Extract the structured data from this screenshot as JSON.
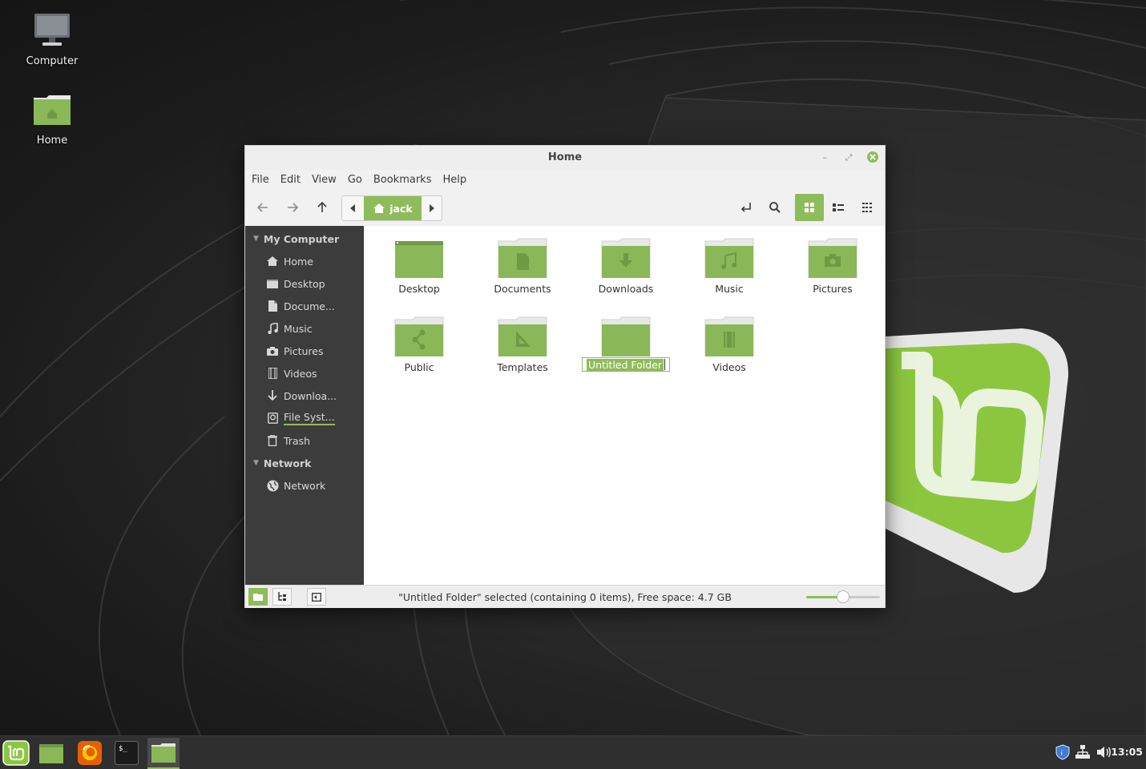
{
  "desktop": {
    "icons": [
      {
        "label": "Computer"
      },
      {
        "label": "Home"
      }
    ]
  },
  "window": {
    "title": "Home",
    "menu": [
      "File",
      "Edit",
      "View",
      "Go",
      "Bookmarks",
      "Help"
    ],
    "breadcrumb": {
      "current": "jack"
    },
    "sidebar": {
      "sections": [
        {
          "title": "My Computer",
          "items": [
            {
              "label": "Home",
              "icon": "home-icon"
            },
            {
              "label": "Desktop",
              "icon": "desktop-icon"
            },
            {
              "label": "Docume...",
              "icon": "document-icon"
            },
            {
              "label": "Music",
              "icon": "music-icon"
            },
            {
              "label": "Pictures",
              "icon": "camera-icon"
            },
            {
              "label": "Videos",
              "icon": "film-icon"
            },
            {
              "label": "Downloa...",
              "icon": "download-icon"
            },
            {
              "label": "File Syst...",
              "icon": "drive-icon"
            },
            {
              "label": "Trash",
              "icon": "trash-icon"
            }
          ]
        },
        {
          "title": "Network",
          "items": [
            {
              "label": "Network",
              "icon": "globe-icon"
            }
          ]
        }
      ]
    },
    "files": [
      {
        "name": "Desktop",
        "emblem": "desktop"
      },
      {
        "name": "Documents",
        "emblem": "document"
      },
      {
        "name": "Downloads",
        "emblem": "download"
      },
      {
        "name": "Music",
        "emblem": "music"
      },
      {
        "name": "Pictures",
        "emblem": "camera"
      },
      {
        "name": "Public",
        "emblem": "share"
      },
      {
        "name": "Templates",
        "emblem": "template"
      },
      {
        "name": "Untitled Folder",
        "emblem": "none",
        "selected": true
      },
      {
        "name": "Videos",
        "emblem": "film"
      }
    ],
    "status_text": "\"Untitled Folder\" selected (containing 0 items), Free space: 4.7 GB",
    "zoom_level": 0.5
  },
  "taskbar": {
    "clock": "13:05"
  },
  "colors": {
    "accent": "#8fbc5a",
    "folder": "#8ab858",
    "folder_dark": "#6f9a44",
    "sidebar": "#3c3c3c"
  }
}
